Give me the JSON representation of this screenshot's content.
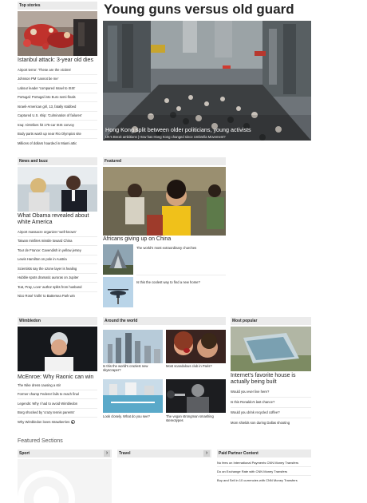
{
  "top_stories": {
    "header": "Top stories",
    "lead": "Istanbul attack: 3-year old dies",
    "links": [
      "Airport terror: 'These are the victims'",
      "Johnson PM 'cannot be me'",
      "Labour leader 'compared Israel to ISIS'",
      "Portugal: Portugal into Euro semi-finals",
      "Israeli-American girl, 13, fatally stabbed",
      "Captured U.S. ship: 'Culmination of failures'",
      "Iraq: Airstrikes hit 175-car ISIS convoy",
      "Body parts wash up near Rio Olympics site",
      "Millions of dollars hoarded in Miami attic"
    ]
  },
  "feature": {
    "title": "Young guns versus old guard",
    "caption": "Hong Kong split between older politicians, young activists",
    "subcaption": "UK's Brexit ambitions | How has Hong Kong changed since Umbrella Movement?"
  },
  "news_buzz": {
    "header": "News and buzz",
    "lead": "What Obama revealed about white America",
    "links": [
      "Airport massacre organizer 'well-known'",
      "Taiwan misfires missile toward China",
      "Tour de France: Cavendish in yellow jersey",
      "Lewis Hamilton on pole in Austria",
      "Scientists say the ozone layer is healing",
      "Hubble spots dramatic auroras on Jupiter",
      "'Eat, Pray, Love' author splits from husband",
      "Nico Rosé 'trolls' to Battersea Park win"
    ]
  },
  "featured": {
    "header": "Featured",
    "lead": "Africans giving up on China",
    "items": [
      "The world's most extraordinary churches",
      "Is this the coolest way to find a new home?"
    ]
  },
  "wimbledon": {
    "header": "Wimbledon",
    "lead": "McEnroe: Why Raonic can win",
    "links": [
      "The Nike dress causing a stir",
      "Former champ Federer fails to reach final",
      "Legends: Why I had to avoid Wimbledon",
      "Borg shocked by 'crazy tennis parents'",
      "Why Wimbledon loves strawberries"
    ]
  },
  "around_world": {
    "header": "Around the world",
    "items": [
      "Is this the world's craziest new skyscraper?",
      "Most scandalous club in Paris?",
      "Look closely. What do you see?",
      "The vegan strongman smashing stereotypes"
    ]
  },
  "most_popular": {
    "header": "Most popular",
    "lead": "Internet's favorite house is actually being built",
    "links": [
      "Would you ever live here?",
      "Is this Ronaldo's last chance?",
      "Would you drink recycled coffee?",
      "Mom shields son during Dallas shooting"
    ]
  },
  "featured_sections": {
    "title": "Featured Sections",
    "sport": "Sport",
    "travel": "Travel",
    "partner": {
      "header": "Paid Partner Content",
      "links": [
        "No fees on International Payments CNN Money Transfers",
        "Do an Exchange Rate with CNN Money Transfers",
        "Buy and Sell in 10 currencies with CNN Money Transfers"
      ]
    }
  },
  "icons": {
    "chevron": "›"
  }
}
